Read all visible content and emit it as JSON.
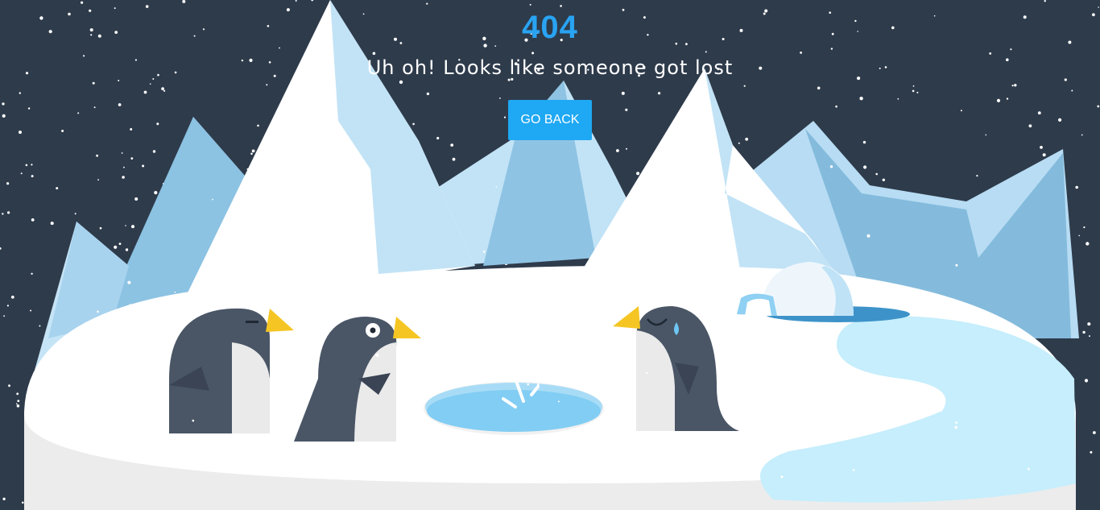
{
  "page": {
    "error_code": "404",
    "message": "Uh oh! Looks like someone got lost",
    "go_back_label": "GO BACK"
  },
  "colors": {
    "background": "#2e3b4b",
    "accent": "#29a3f2",
    "button": "#1fa8f3",
    "mountain_light": "#c2e3f6",
    "mountain_mid": "#89bfe0",
    "snow": "#ffffff",
    "ice_water": "#8fd3f5",
    "penguin_body": "#4a5666",
    "penguin_beak": "#f5c623"
  },
  "illustration": {
    "icons": [
      "mountains-illustration",
      "igloo-icon",
      "penguin-icon",
      "ice-hole-icon",
      "snowflakes"
    ]
  }
}
